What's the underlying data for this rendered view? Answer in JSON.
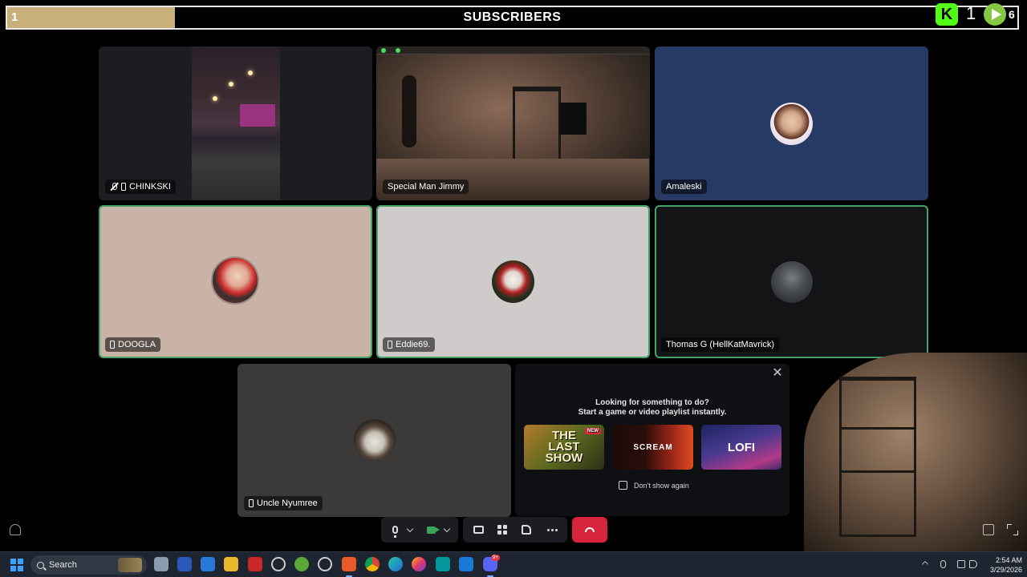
{
  "subscriber_goal": {
    "current": "1",
    "title": "SUBSCRIBERS",
    "progress_fraction": 0.166,
    "kick_count": "1",
    "rumble_count": "6",
    "fill_color": "#c9b07a",
    "kick_color": "#53fc18",
    "rumble_color": "#85c742"
  },
  "participants": [
    {
      "name": "CHINKSKI",
      "on_mobile": true,
      "muted": true,
      "speaking": false,
      "kind": "video"
    },
    {
      "name": "Special Man Jimmy",
      "on_mobile": false,
      "muted": false,
      "speaking": false,
      "kind": "video"
    },
    {
      "name": "Amaleski",
      "on_mobile": false,
      "muted": false,
      "speaking": false,
      "kind": "avatar",
      "bg": "#273a63"
    },
    {
      "name": "DOOGLA",
      "on_mobile": true,
      "muted": false,
      "speaking": true,
      "kind": "avatar",
      "bg": "#c8b3a6"
    },
    {
      "name": "Eddie69.",
      "on_mobile": true,
      "muted": false,
      "speaking": true,
      "kind": "avatar",
      "bg": "#cfcbca"
    },
    {
      "name": "Thomas G (HellKatMavrick)",
      "on_mobile": false,
      "muted": false,
      "speaking": true,
      "kind": "avatar",
      "bg": "#121416"
    },
    {
      "name": "Uncle Nyumree",
      "on_mobile": true,
      "muted": false,
      "speaking": false,
      "kind": "avatar",
      "bg": "#3b3a38"
    }
  ],
  "activity_popup": {
    "title_line1": "Looking for something to do?",
    "title_line2": "Start a game or video playlist instantly.",
    "close_icon": "close-icon",
    "cards": [
      {
        "label": "THE LAST SHOW",
        "badge": "NEW"
      },
      {
        "label": "SCREAM"
      },
      {
        "label": "LOFI"
      }
    ],
    "dont_show_label": "Don't show again"
  },
  "call_controls": {
    "mic_icon": "microphone-icon",
    "camera_icon": "camera-icon",
    "camera_on_color": "#3ba55c",
    "screen_share_icon": "screen-share-icon",
    "activities_icon": "activities-icon",
    "soundboard_icon": "soundboard-icon",
    "more_icon": "more-options-icon",
    "end_call_icon": "hang-up-icon",
    "end_call_color": "#d5243b"
  },
  "taskbar": {
    "search_placeholder": "Search",
    "time": "2:54 AM",
    "date": "3/29/2026",
    "pinned_apps": [
      "windows-start-icon",
      "app-icon",
      "outlook-icon",
      "app-icon",
      "file-explorer-icon",
      "app-icon",
      "clock-app-icon",
      "app-icon",
      "app-icon",
      "brave-browser-icon",
      "chrome-icon",
      "edge-icon",
      "firefox-icon",
      "arduino-icon",
      "vscode-icon",
      "discord-icon"
    ],
    "discord_badge": "9+"
  }
}
